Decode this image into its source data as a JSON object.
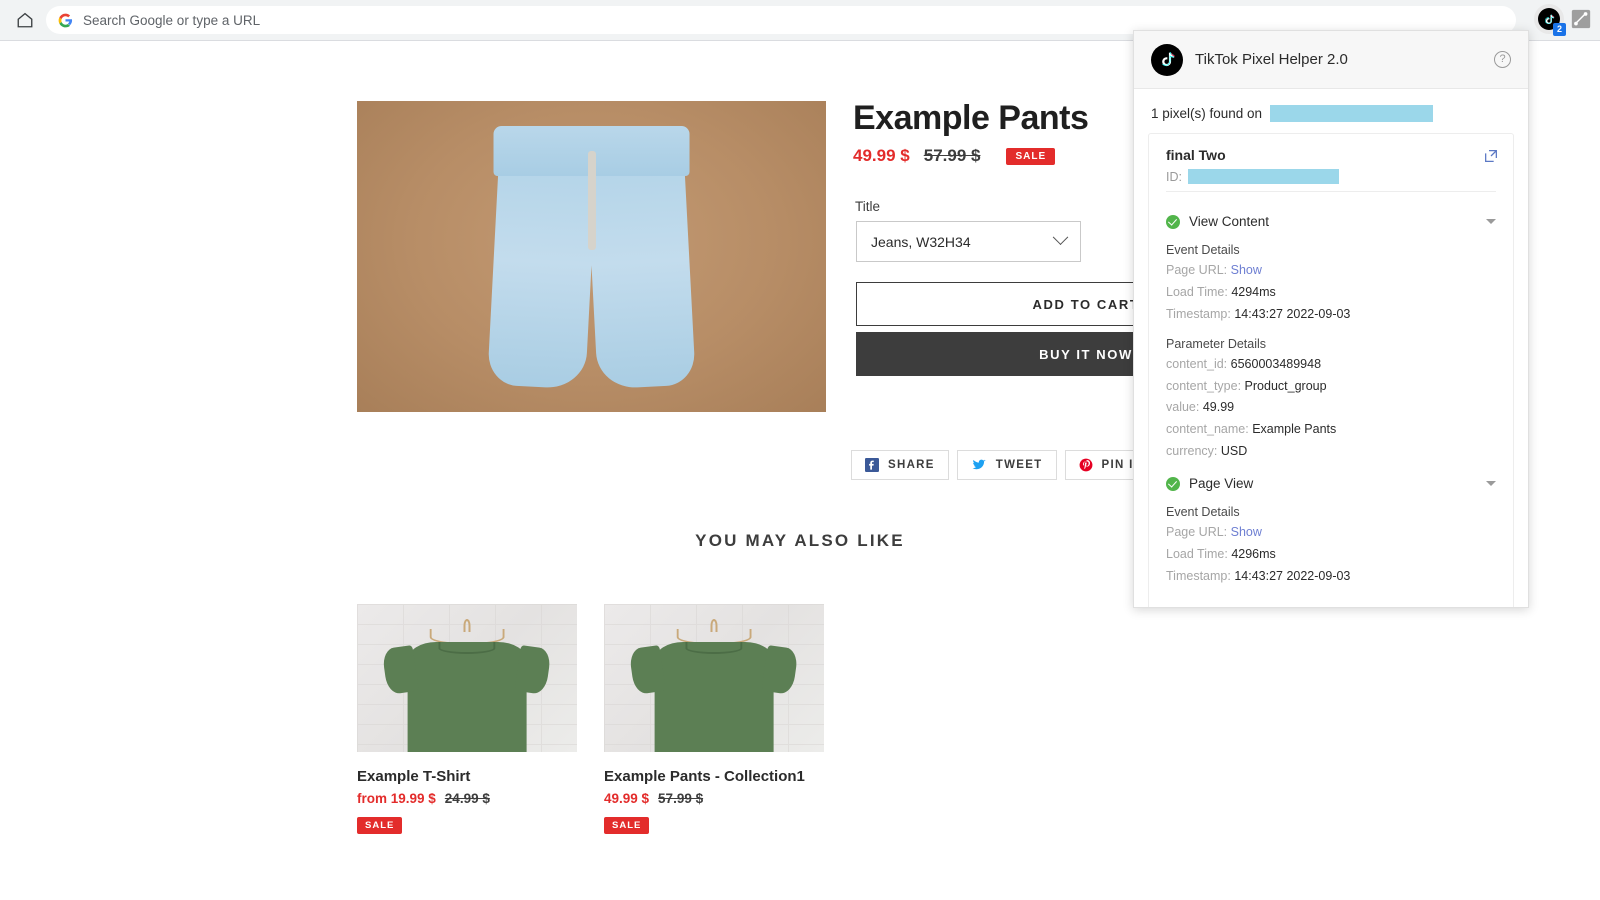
{
  "browser": {
    "home_icon": "home-icon",
    "omnibox_placeholder": "Search Google or type a URL",
    "google_icon": "google-g-icon",
    "extension_badge_count": "2",
    "extension_icon": "tiktok-icon",
    "puzzle_icon": "extensions-puzzle-icon"
  },
  "product": {
    "title": "Example Pants",
    "price_now": "49.99 $",
    "price_old": "57.99 $",
    "sale_badge": "SALE",
    "option_label": "Title",
    "option_value": "Jeans, W32H34",
    "add_to_cart": "ADD TO CART",
    "buy_it_now": "BUY IT NOW",
    "share_buttons": [
      {
        "label": "SHARE",
        "icon": "facebook-icon",
        "color": "#3b5998"
      },
      {
        "label": "TWEET",
        "icon": "twitter-icon",
        "color": "#1da1f2"
      },
      {
        "label": "PIN IT",
        "icon": "pinterest-icon",
        "color": "#e60023"
      }
    ]
  },
  "recommendations": {
    "heading": "YOU MAY ALSO LIKE",
    "items": [
      {
        "title": "Example T-Shirt",
        "price_now": "from 19.99 $",
        "price_old": "24.99 $",
        "sale_badge": "SALE"
      },
      {
        "title": "Example Pants - Collection1",
        "price_now": "49.99 $",
        "price_old": "57.99 $",
        "sale_badge": "SALE"
      }
    ]
  },
  "popup": {
    "title": "TikTok Pixel Helper 2.0",
    "help_icon": "question-mark-icon",
    "found_text": "1 pixel(s) found on",
    "found_url_redacted": true,
    "pixel": {
      "name": "final Two",
      "id_label": "ID:",
      "id_redacted": true,
      "open_icon": "external-link-icon"
    },
    "events": [
      {
        "name": "View Content",
        "status_icon": "green-check-icon",
        "event_details_heading": "Event Details",
        "details": [
          {
            "key": "Page URL:",
            "value": "Show",
            "is_link": true
          },
          {
            "key": "Load Time:",
            "value": "4294ms",
            "is_link": false
          },
          {
            "key": "Timestamp:",
            "value": "14:43:27 2022-09-03",
            "is_link": false
          }
        ],
        "parameter_details_heading": "Parameter Details",
        "parameters": [
          {
            "key": "content_id:",
            "value": "6560003489948"
          },
          {
            "key": "content_type:",
            "value": "Product_group"
          },
          {
            "key": "value:",
            "value": "49.99"
          },
          {
            "key": "content_name:",
            "value": "Example Pants"
          },
          {
            "key": "currency:",
            "value": "USD"
          }
        ]
      },
      {
        "name": "Page View",
        "status_icon": "green-check-icon",
        "event_details_heading": "Event Details",
        "details": [
          {
            "key": "Page URL:",
            "value": "Show",
            "is_link": true
          },
          {
            "key": "Load Time:",
            "value": "4296ms",
            "is_link": false
          },
          {
            "key": "Timestamp:",
            "value": "14:43:27 2022-09-03",
            "is_link": false
          }
        ],
        "parameter_details_heading": "",
        "parameters": []
      }
    ]
  },
  "colors": {
    "sale_red": "#e32c2b",
    "accent_blue": "#1a73e8",
    "redact_blue": "#9bd7ea",
    "check_green": "#52b54b",
    "dark_button": "#3d3d3d"
  }
}
